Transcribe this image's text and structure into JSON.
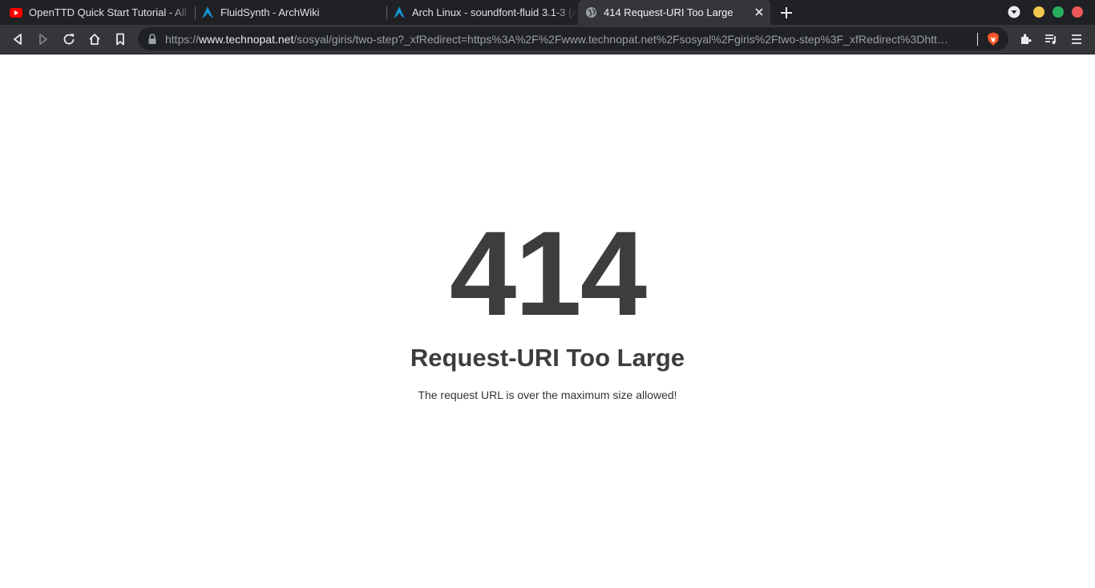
{
  "tabs": [
    {
      "title": "OpenTTD Quick Start Tutorial - All",
      "favicon": "youtube-icon",
      "active": false
    },
    {
      "title": "FluidSynth - ArchWiki",
      "favicon": "arch-linux-icon",
      "active": false
    },
    {
      "title": "Arch Linux - soundfont-fluid 3.1-3 (a",
      "favicon": "arch-linux-icon",
      "active": false
    },
    {
      "title": "414 Request-URI Too Large",
      "favicon": "globe-icon",
      "active": true
    }
  ],
  "address_bar": {
    "scheme": "https://",
    "host": "www.technopat.net",
    "path": "/sosyal/giris/two-step?_xfRedirect=https%3A%2F%2Fwww.technopat.net%2Fsosyal%2Fgiris%2Ftwo-step%3F_xfRedirect%3Dhtt…"
  },
  "page": {
    "code": "414",
    "heading": "Request-URI Too Large",
    "message": "The request URL is over the maximum size allowed!"
  },
  "colors": {
    "tabstrip_bg": "#202124",
    "toolbar_bg": "#35363a",
    "error_text": "#3d3d3d",
    "window_minimize": "#f2c94c",
    "window_maximize": "#27ae60",
    "window_close": "#eb5757"
  }
}
